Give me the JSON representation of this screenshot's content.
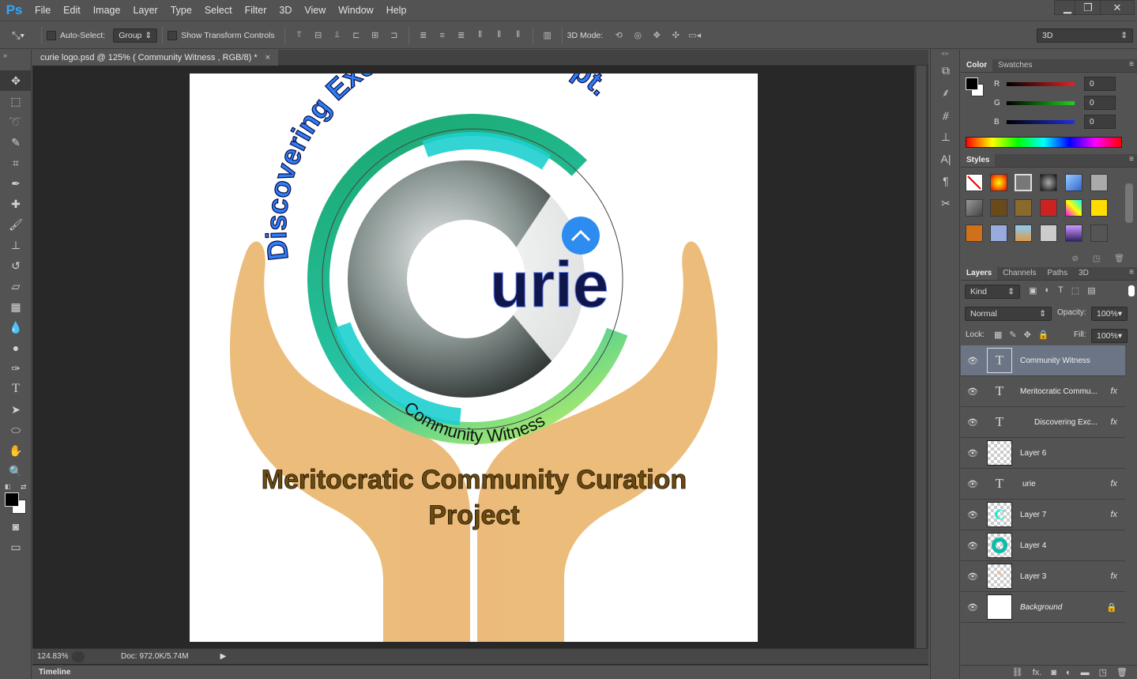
{
  "app": {
    "logo": "Ps"
  },
  "menu": [
    "File",
    "Edit",
    "Image",
    "Layer",
    "Type",
    "Select",
    "Filter",
    "3D",
    "View",
    "Window",
    "Help"
  ],
  "window_controls": {
    "minimize": "▁",
    "restore": "❐",
    "close": "✕"
  },
  "options": {
    "auto_select_label": "Auto-Select:",
    "auto_select_value": "Group",
    "transform_label": "Show Transform Controls",
    "mode_3d_label": "3D Mode:",
    "workspace": "3D"
  },
  "document": {
    "tab_title": "curie logo.psd @ 125% ( Community Witness , RGB/8) *",
    "tab_close": "×",
    "zoom": "124.83%",
    "doc_size": "Doc: 972.0K/5.74M"
  },
  "timeline_label": "Timeline",
  "artwork": {
    "arc_text": "Discovering Exceptional Concept.",
    "brand": "urie",
    "community": "Community Witness",
    "headline1": "Meritocratic Community Curation",
    "headline2": "Project"
  },
  "color_panel": {
    "tabs": [
      "Color",
      "Swatches"
    ],
    "channels": [
      {
        "label": "R",
        "value": "0",
        "color": "#e52020"
      },
      {
        "label": "G",
        "value": "0",
        "color": "#20d020"
      },
      {
        "label": "B",
        "value": "0",
        "color": "#2030e0"
      }
    ]
  },
  "styles_panel": {
    "title": "Styles"
  },
  "layers_panel": {
    "tabs": [
      "Layers",
      "Channels",
      "Paths",
      "3D"
    ],
    "kind": "Kind",
    "blend_mode": "Normal",
    "opacity_label": "Opacity:",
    "opacity": "100%",
    "lock_label": "Lock:",
    "fill_label": "Fill:",
    "fill": "100%",
    "layers": [
      {
        "name": "Community Witness",
        "type": "text",
        "fx": "",
        "selected": true
      },
      {
        "name": "Meritocratic Commu...",
        "type": "text",
        "fx": "fx",
        "selected": false
      },
      {
        "name": "Discovering Exc...",
        "type": "text",
        "fx": "fx",
        "selected": false
      },
      {
        "name": "Layer 6",
        "type": "raster",
        "fx": "",
        "selected": false
      },
      {
        "name": "urie",
        "type": "text",
        "fx": "fx",
        "selected": false
      },
      {
        "name": "Layer 7",
        "type": "raster",
        "fx": "fx",
        "selected": false
      },
      {
        "name": "Layer 4",
        "type": "raster",
        "fx": "",
        "selected": false
      },
      {
        "name": "Layer 3",
        "type": "raster",
        "fx": "fx",
        "selected": false
      },
      {
        "name": "Background",
        "type": "background",
        "fx": "",
        "selected": false
      }
    ]
  },
  "accent": "#31a8ff"
}
